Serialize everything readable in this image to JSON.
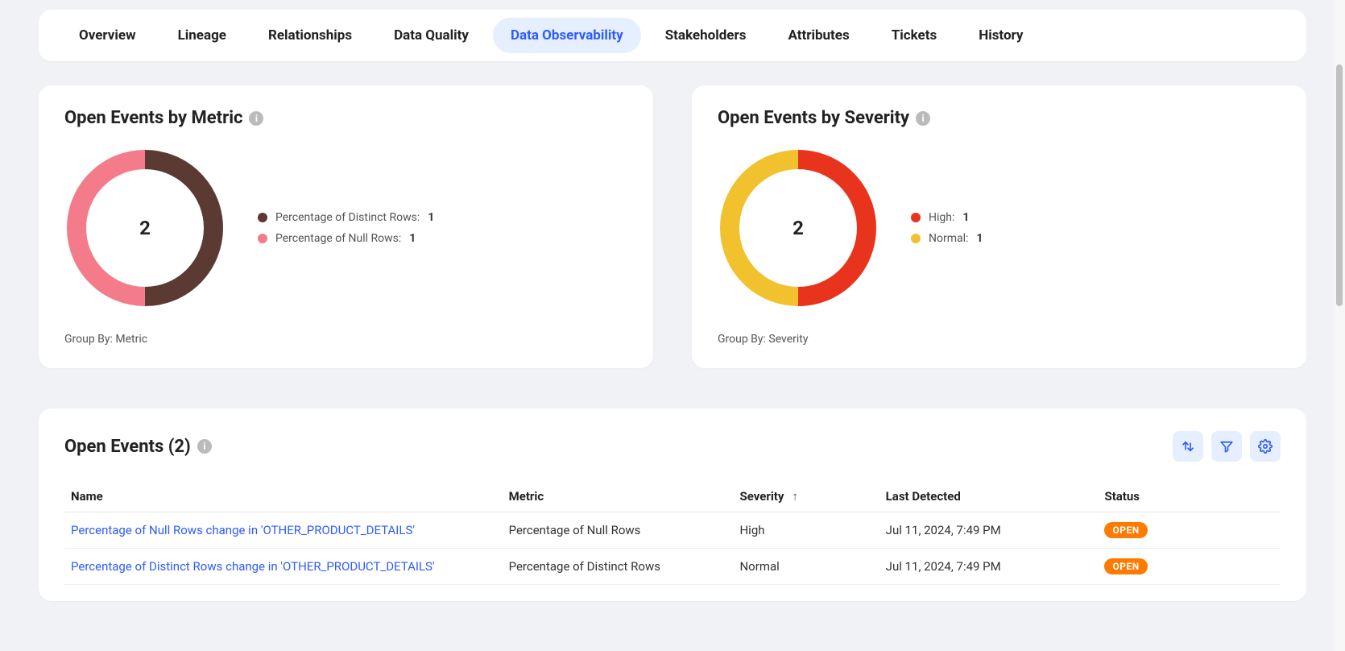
{
  "tabs": [
    {
      "label": "Overview",
      "active": false
    },
    {
      "label": "Lineage",
      "active": false
    },
    {
      "label": "Relationships",
      "active": false
    },
    {
      "label": "Data Quality",
      "active": false
    },
    {
      "label": "Data Observability",
      "active": true
    },
    {
      "label": "Stakeholders",
      "active": false
    },
    {
      "label": "Attributes",
      "active": false
    },
    {
      "label": "Tickets",
      "active": false
    },
    {
      "label": "History",
      "active": false
    }
  ],
  "metric_card": {
    "title": "Open Events by Metric",
    "center_value": "2",
    "legend": [
      {
        "label": "Percentage of Distinct Rows:",
        "value": "1",
        "color": "#5a3a32"
      },
      {
        "label": "Percentage of Null Rows:",
        "value": "1",
        "color": "#f47c8a"
      }
    ],
    "groupby": "Group By: Metric"
  },
  "severity_card": {
    "title": "Open Events by Severity",
    "center_value": "2",
    "legend": [
      {
        "label": "High:",
        "value": "1",
        "color": "#e8341c"
      },
      {
        "label": "Normal:",
        "value": "1",
        "color": "#f2c22e"
      }
    ],
    "groupby": "Group By: Severity"
  },
  "events_table": {
    "title": "Open Events (2)",
    "columns": [
      "Name",
      "Metric",
      "Severity",
      "Last Detected",
      "Status"
    ],
    "sort_col_index": 2,
    "rows": [
      {
        "name": "Percentage of Null Rows change in 'OTHER_PRODUCT_DETAILS'",
        "metric": "Percentage of Null Rows",
        "severity": "High",
        "last": "Jul 11, 2024, 7:49 PM",
        "status": "OPEN"
      },
      {
        "name": "Percentage of Distinct Rows change in 'OTHER_PRODUCT_DETAILS'",
        "metric": "Percentage of Distinct Rows",
        "severity": "Normal",
        "last": "Jul 11, 2024, 7:49 PM",
        "status": "OPEN"
      }
    ]
  },
  "chart_data": [
    {
      "type": "pie",
      "title": "Open Events by Metric",
      "series": [
        {
          "name": "Percentage of Distinct Rows",
          "value": 1,
          "color": "#5a3a32"
        },
        {
          "name": "Percentage of Null Rows",
          "value": 1,
          "color": "#f47c8a"
        }
      ],
      "total": 2
    },
    {
      "type": "pie",
      "title": "Open Events by Severity",
      "series": [
        {
          "name": "High",
          "value": 1,
          "color": "#e8341c"
        },
        {
          "name": "Normal",
          "value": 1,
          "color": "#f2c22e"
        }
      ],
      "total": 2
    }
  ]
}
